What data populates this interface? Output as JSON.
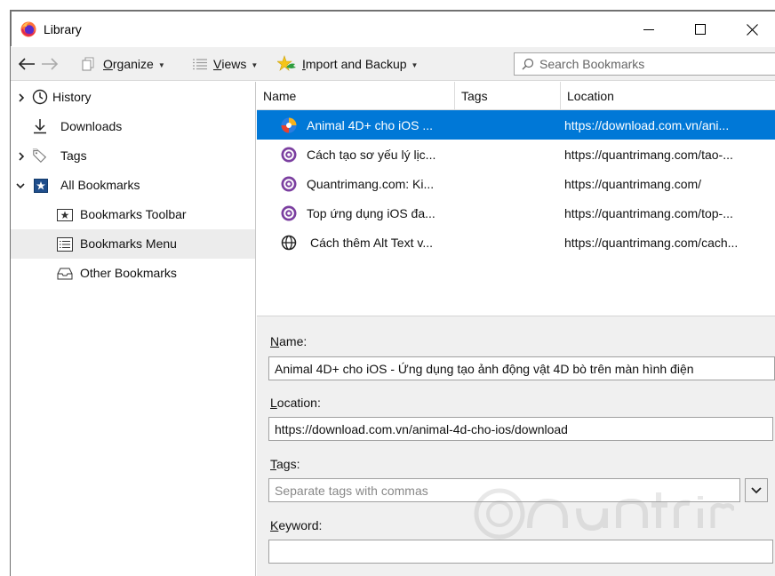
{
  "window": {
    "title": "Library",
    "controls": {
      "minimize": "minimize",
      "maximize": "maximize",
      "close": "close"
    }
  },
  "toolbar": {
    "organize": {
      "accel": "O",
      "rest": "rganize"
    },
    "views": {
      "accel": "V",
      "rest": "iews"
    },
    "import_backup": {
      "accel": "I",
      "rest": "mport and Backup"
    },
    "search_placeholder": "Search Bookmarks"
  },
  "sidebar": {
    "items": [
      {
        "label": "History",
        "icon": "clock-icon",
        "twisty": "collapsed"
      },
      {
        "label": "Downloads",
        "icon": "download-arrow-icon",
        "twisty": "none"
      },
      {
        "label": "Tags",
        "icon": "tag-icon",
        "twisty": "collapsed"
      },
      {
        "label": "All Bookmarks",
        "icon": "star-folder-icon",
        "twisty": "expanded"
      },
      {
        "label": "Bookmarks Toolbar",
        "icon": "toolbar-star-icon",
        "twisty": "none"
      },
      {
        "label": "Bookmarks Menu",
        "icon": "menu-list-icon",
        "twisty": "none",
        "selected": true
      },
      {
        "label": "Other Bookmarks",
        "icon": "inbox-folder-icon",
        "twisty": "none"
      }
    ]
  },
  "table": {
    "columns": [
      "Name",
      "Tags",
      "Location"
    ],
    "rows": [
      {
        "name": "Animal 4D+ cho iOS ...",
        "tags": "",
        "location": "https://download.com.vn/ani...",
        "icon": "download-site-favicon",
        "selected": true
      },
      {
        "name": "Cách tạo sơ yếu lý lịc...",
        "tags": "",
        "location": "https://quantrimang.com/tao-...",
        "icon": "quantrimang-favicon"
      },
      {
        "name": "Quantrimang.com: Ki...",
        "tags": "",
        "location": "https://quantrimang.com/",
        "icon": "quantrimang-favicon"
      },
      {
        "name": "Top ứng dụng iOS đa...",
        "tags": "",
        "location": "https://quantrimang.com/top-...",
        "icon": "quantrimang-favicon"
      },
      {
        "name": "Cách thêm Alt Text v...",
        "tags": "",
        "location": "https://quantrimang.com/cach...",
        "icon": "globe-icon"
      }
    ]
  },
  "details": {
    "name_label": {
      "accel": "N",
      "rest": "ame:"
    },
    "name_value": "Animal 4D+ cho iOS - Ứng dụng tạo ảnh động vật 4D bò trên màn hình điện",
    "location_label": {
      "accel": "L",
      "rest": "ocation:"
    },
    "location_value": "https://download.com.vn/animal-4d-cho-ios/download",
    "tags_label": {
      "accel": "T",
      "rest": "ags:"
    },
    "tags_placeholder": "Separate tags with commas",
    "keyword_label": {
      "accel": "K",
      "rest": "eyword:"
    },
    "keyword_value": ""
  },
  "colors": {
    "selection": "#0078d7",
    "quantrimang_purple": "#7b3fa0",
    "firefox_orange": "#ff7139"
  }
}
